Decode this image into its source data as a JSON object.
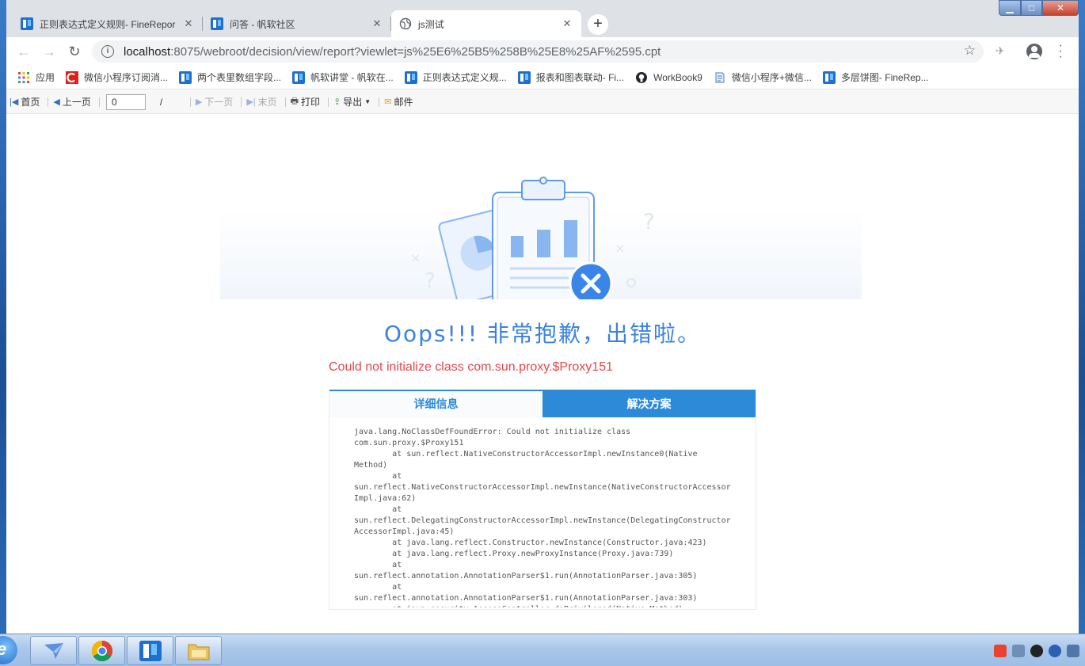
{
  "browser": {
    "tabs": [
      {
        "title": "正则表达式定义规则- FineRepor",
        "active": false,
        "icon": "finereport-icon"
      },
      {
        "title": "问答 - 帆软社区",
        "active": false,
        "icon": "finereport-icon"
      },
      {
        "title": "js测试",
        "active": true,
        "icon": "globe-icon"
      }
    ],
    "new_tab": "+",
    "url_host": "localhost",
    "url_rest": ":8075/webroot/decision/view/report?viewlet=js%25E6%25B5%258B%25E8%25AF%2595.cpt",
    "window_controls": {
      "minimize": "▁",
      "maximize": "□",
      "close": "✕"
    }
  },
  "bookmarks": [
    {
      "label": "应用",
      "icon": "apps-grid-icon"
    },
    {
      "label": "微信小程序订阅消...",
      "icon": "red-c-icon"
    },
    {
      "label": "两个表里数组字段...",
      "icon": "finereport-icon"
    },
    {
      "label": "帆软讲堂 - 帆软在...",
      "icon": "finereport-icon"
    },
    {
      "label": "正则表达式定义规...",
      "icon": "finereport-icon"
    },
    {
      "label": "报表和图表联动- Fi...",
      "icon": "finereport-icon"
    },
    {
      "label": "WorkBook9",
      "icon": "github-icon"
    },
    {
      "label": "微信小程序+微信...",
      "icon": "document-icon"
    },
    {
      "label": "多层饼图- FineRep...",
      "icon": "finereport-icon"
    }
  ],
  "report_toolbar": {
    "first": "首页",
    "prev": "上一页",
    "page_value": "0",
    "slash": "/",
    "next": "下一页",
    "last": "末页",
    "print": "打印",
    "export": "导出",
    "mail": "邮件"
  },
  "error_page": {
    "headline": "Oops!!! 非常抱歉，出错啦。",
    "message": "Could not initialize class com.sun.proxy.$Proxy151",
    "tab_detail": "详细信息",
    "tab_solution": "解决方案",
    "stack_trace": "java.lang.NoClassDefFoundError: Could not initialize class\ncom.sun.proxy.$Proxy151\n        at sun.reflect.NativeConstructorAccessorImpl.newInstance0(Native\nMethod)\n        at\nsun.reflect.NativeConstructorAccessorImpl.newInstance(NativeConstructorAccessor\nImpl.java:62)\n        at\nsun.reflect.DelegatingConstructorAccessorImpl.newInstance(DelegatingConstructor\nAccessorImpl.java:45)\n        at java.lang.reflect.Constructor.newInstance(Constructor.java:423)\n        at java.lang.reflect.Proxy.newProxyInstance(Proxy.java:739)\n        at\nsun.reflect.annotation.AnnotationParser$1.run(AnnotationParser.java:305)\n        at\nsun.reflect.annotation.AnnotationParser$1.run(AnnotationParser.java:303)\n        at java.security.AccessController.doPrivileged(Native Method)"
  },
  "taskbar": {
    "apps": [
      "messenger-bird-icon",
      "chrome-icon",
      "finereport-icon",
      "file-explorer-icon"
    ]
  },
  "colors": {
    "accent": "#2d8ad9",
    "headline": "#3b82e0",
    "error": "#e5474a"
  }
}
